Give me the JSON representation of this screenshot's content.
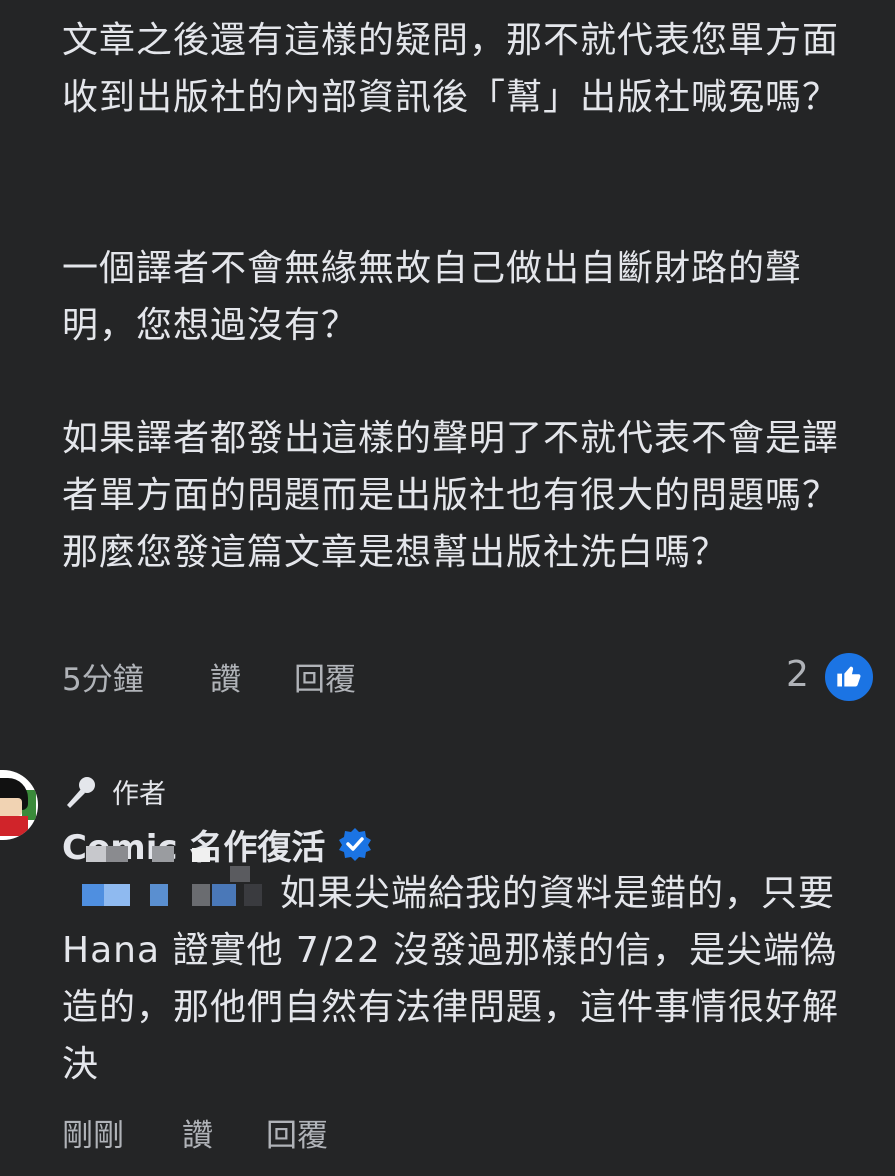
{
  "comment": {
    "paragraphs": [
      "文章之後還有這樣的疑問，那不就代表您單方面收到出版社的內部資訊後「幫」出版社喊冤嗎？",
      "一個譯者不會無緣無故自己做出自斷財路的聲明，您想過沒有？",
      "如果譯者都發出這樣的聲明了不就代表不會是譯者單方面的問題而是出版社也有很大的問題嗎？那麼您發這篇文章是想幫出版社洗白嗎？"
    ],
    "time": "5分鐘",
    "like_label": "讚",
    "reply_label": "回覆",
    "reaction_count": "2",
    "reaction_color": "#1b74e4"
  },
  "reply": {
    "author_badge": "作者",
    "author_name": "Comic 名作復活",
    "verified_color": "#1b74e4",
    "text": "如果尖端給我的資料是錯的，只要 Hana 證實他 7/22 沒發過那樣的信，是尖端偽造的，那他們自然有法律問題，這件事情很好解決",
    "time": "剛剛",
    "like_label": "讚",
    "reply_label": "回覆"
  },
  "icons": {
    "reaction": "thumbs-up-icon",
    "badge": "microphone-icon",
    "verified": "verified-badge-icon"
  }
}
